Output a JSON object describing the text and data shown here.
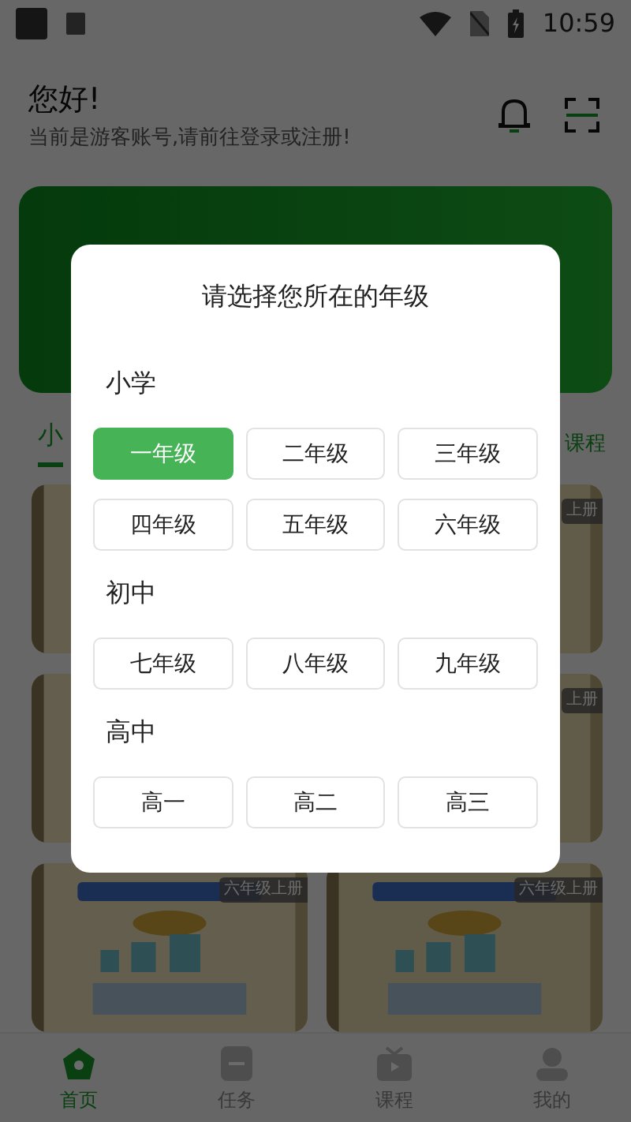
{
  "status_bar": {
    "time": "10:59"
  },
  "header": {
    "greeting": "您好!",
    "subtitle": "当前是游客账号,请前往登录或注册!"
  },
  "tabs": [
    {
      "label": "小",
      "selected": true
    }
  ],
  "more_link": "课程",
  "courses": [
    {
      "kind": "picture"
    },
    {
      "kind": "picture",
      "badge": "上册"
    },
    {
      "kind": "picture"
    },
    {
      "kind": "picture",
      "badge": "上册"
    },
    {
      "kind": "picture",
      "badge": "六年级上册"
    },
    {
      "kind": "picture",
      "badge": "六年级上册"
    }
  ],
  "bottom_nav": [
    {
      "label": "首页",
      "selected": true
    },
    {
      "label": "任务",
      "selected": false
    },
    {
      "label": "课程",
      "selected": false
    },
    {
      "label": "我的",
      "selected": false
    }
  ],
  "dialog": {
    "title": "请选择您所在的年级",
    "groups": [
      {
        "heading": "小学",
        "options": [
          {
            "label": "一年级",
            "selected": true
          },
          {
            "label": "二年级",
            "selected": false
          },
          {
            "label": "三年级",
            "selected": false
          },
          {
            "label": "四年级",
            "selected": false
          },
          {
            "label": "五年级",
            "selected": false
          },
          {
            "label": "六年级",
            "selected": false
          }
        ]
      },
      {
        "heading": "初中",
        "options": [
          {
            "label": "七年级",
            "selected": false
          },
          {
            "label": "八年级",
            "selected": false
          },
          {
            "label": "九年级",
            "selected": false
          }
        ]
      },
      {
        "heading": "高中",
        "options": [
          {
            "label": "高一",
            "selected": false
          },
          {
            "label": "高二",
            "selected": false
          },
          {
            "label": "高三",
            "selected": false
          }
        ]
      }
    ]
  }
}
